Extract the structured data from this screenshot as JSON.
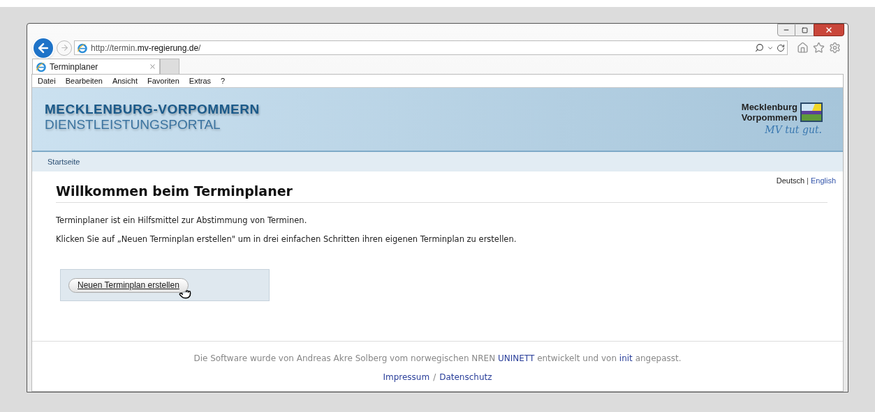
{
  "browser": {
    "url_prefix": "http://termin.",
    "url_domain": "mv-regierung.de",
    "url_suffix": "/",
    "tabs": [
      {
        "label": "Terminplaner",
        "selected": true
      }
    ],
    "menu": [
      "Datei",
      "Bearbeiten",
      "Ansicht",
      "Favoriten",
      "Extras",
      "?"
    ]
  },
  "header": {
    "title": "MECKLENBURG-VORPOMMERN",
    "subtitle": "DIENSTLEISTUNGSPORTAL",
    "logo_line1": "Mecklenburg",
    "logo_line2": "Vorpommern",
    "slogan": "MV tut gut."
  },
  "nav": [
    "Startseite"
  ],
  "languages": [
    {
      "label": "Deutsch",
      "selected": true
    },
    {
      "label": "English",
      "selected": false
    }
  ],
  "language_separator": "|",
  "heading": "Willkommen beim Terminplaner",
  "paragraphs": [
    "Terminplaner ist ein Hilfsmittel zur Abstimmung von Terminen.",
    "Klicken Sie auf „Neuen Terminplan erstellen\" um in drei einfachen Schritten ihren eigenen Terminplan zu erstellen."
  ],
  "create_button": "Neuen Terminplan erstellen",
  "footer": {
    "before": "Die Software wurde von Andreas Akre Solberg vom norwegischen NREN ",
    "link1": "UNINETT",
    "middle": " entwickelt und von ",
    "link2": "init",
    "after": " angepasst.",
    "links": [
      "Impressum",
      "Datenschutz"
    ],
    "separator": "/"
  }
}
